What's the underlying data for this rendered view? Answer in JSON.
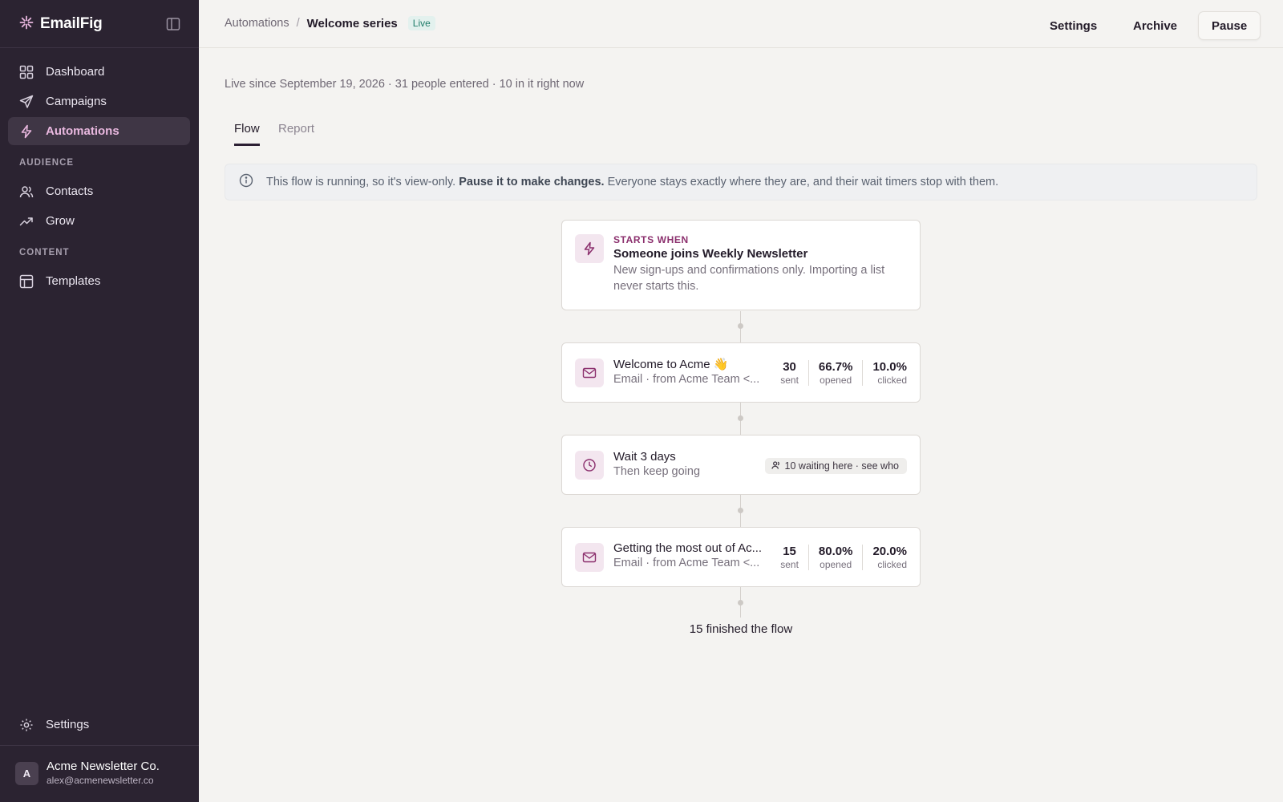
{
  "app": {
    "name": "EmailFig"
  },
  "sidebar": {
    "main_items": [
      {
        "label": "Dashboard",
        "icon": "grid-icon"
      },
      {
        "label": "Campaigns",
        "icon": "send-icon"
      },
      {
        "label": "Automations",
        "icon": "lightning-icon",
        "active": true
      }
    ],
    "audience_label": "AUDIENCE",
    "audience_items": [
      {
        "label": "Contacts",
        "icon": "users-icon"
      },
      {
        "label": "Grow",
        "icon": "trending-up-icon"
      }
    ],
    "content_label": "CONTENT",
    "content_items": [
      {
        "label": "Templates",
        "icon": "layout-icon"
      }
    ],
    "settings_label": "Settings",
    "user": {
      "initial": "A",
      "name": "Acme Newsletter Co.",
      "email": "alex@acmenewsletter.co"
    }
  },
  "header": {
    "breadcrumb_root": "Automations",
    "breadcrumb_sep": "/",
    "title": "Welcome series",
    "status": "Live",
    "settings_label": "Settings",
    "archive_label": "Archive",
    "pause_label": "Pause"
  },
  "meta": "Live since September 19, 2026 · 31 people entered · 10 in it right now",
  "tabs": [
    {
      "label": "Flow",
      "active": true
    },
    {
      "label": "Report",
      "active": false
    }
  ],
  "notice": {
    "before": "This flow is running, so it's view-only.",
    "bold": "Pause it to make changes.",
    "after": "Everyone stays exactly where they are, and their wait timers stop with them."
  },
  "flow": {
    "trigger": {
      "kicker": "STARTS WHEN",
      "title": "Someone joins Weekly Newsletter",
      "description": "New sign-ups and confirmations only. Importing a list never starts this."
    },
    "email1": {
      "title": "Welcome to Acme 👋",
      "sub": "Email · from Acme Team <...",
      "stats": [
        {
          "value": "30",
          "label": "sent"
        },
        {
          "value": "66.7%",
          "label": "opened"
        },
        {
          "value": "10.0%",
          "label": "clicked"
        }
      ]
    },
    "wait": {
      "title": "Wait 3 days",
      "sub": "Then keep going",
      "waiting": "10 waiting here · see who"
    },
    "email2": {
      "title": "Getting the most out of Ac...",
      "sub": "Email · from Acme Team <...",
      "stats": [
        {
          "value": "15",
          "label": "sent"
        },
        {
          "value": "80.0%",
          "label": "opened"
        },
        {
          "value": "20.0%",
          "label": "clicked"
        }
      ]
    },
    "finished": "15 finished the flow"
  },
  "colors": {
    "sidebar": "#2b2331",
    "accent": "#8b2f6d",
    "active_nav_text": "#e9b8df",
    "live_badge": "#1e7c69"
  }
}
